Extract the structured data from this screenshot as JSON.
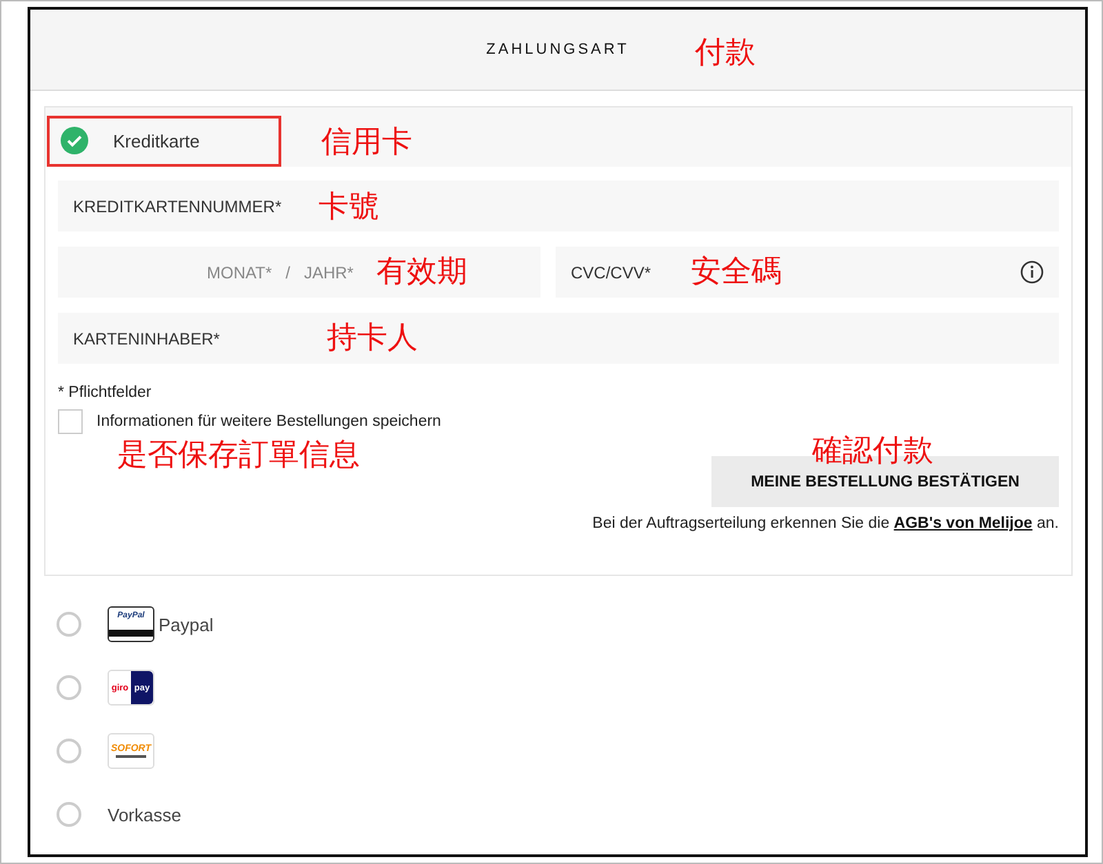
{
  "header": {
    "title": "ZAHLUNGSART"
  },
  "methods": [
    {
      "kind": "card",
      "label": "Kreditkarte",
      "selected": true,
      "highlighted": true
    },
    {
      "kind": "paypal",
      "logo": "PayPal",
      "label": "Paypal",
      "selected": false
    },
    {
      "kind": "giropay",
      "logo": [
        "giro",
        "pay"
      ],
      "selected": false
    },
    {
      "kind": "sofort",
      "logo": "SOFORT",
      "selected": false
    },
    {
      "kind": "plain",
      "label": "Vorkasse",
      "selected": false
    }
  ],
  "card_form": {
    "number": {
      "placeholder": "KREDITKARTENNUMMER*"
    },
    "month": {
      "placeholder": "MONAT*"
    },
    "separator": "/",
    "year": {
      "placeholder": "JAHR*"
    },
    "cvc": {
      "placeholder": "CVC/CVV*"
    },
    "holder": {
      "placeholder": "KARTENINHABER*"
    },
    "required_note": "* Pflichtfelder",
    "save_info": {
      "label": "Informationen für weitere Bestellungen speichern",
      "checked": false
    },
    "confirm_button": "MEINE BESTELLUNG BESTÄTIGEN",
    "terms": {
      "before": "Bei der Auftragserteilung erkennen Sie die",
      "link": "AGB's von Melijoe",
      "after": "an."
    }
  },
  "annotations": [
    {
      "text": "付款"
    },
    {
      "text": "信用卡"
    },
    {
      "text": "卡號"
    },
    {
      "text": "有效期"
    },
    {
      "text": "安全碼"
    },
    {
      "text": "持卡人"
    },
    {
      "text": "是否保存訂單信息"
    },
    {
      "text": "確認付款"
    }
  ]
}
